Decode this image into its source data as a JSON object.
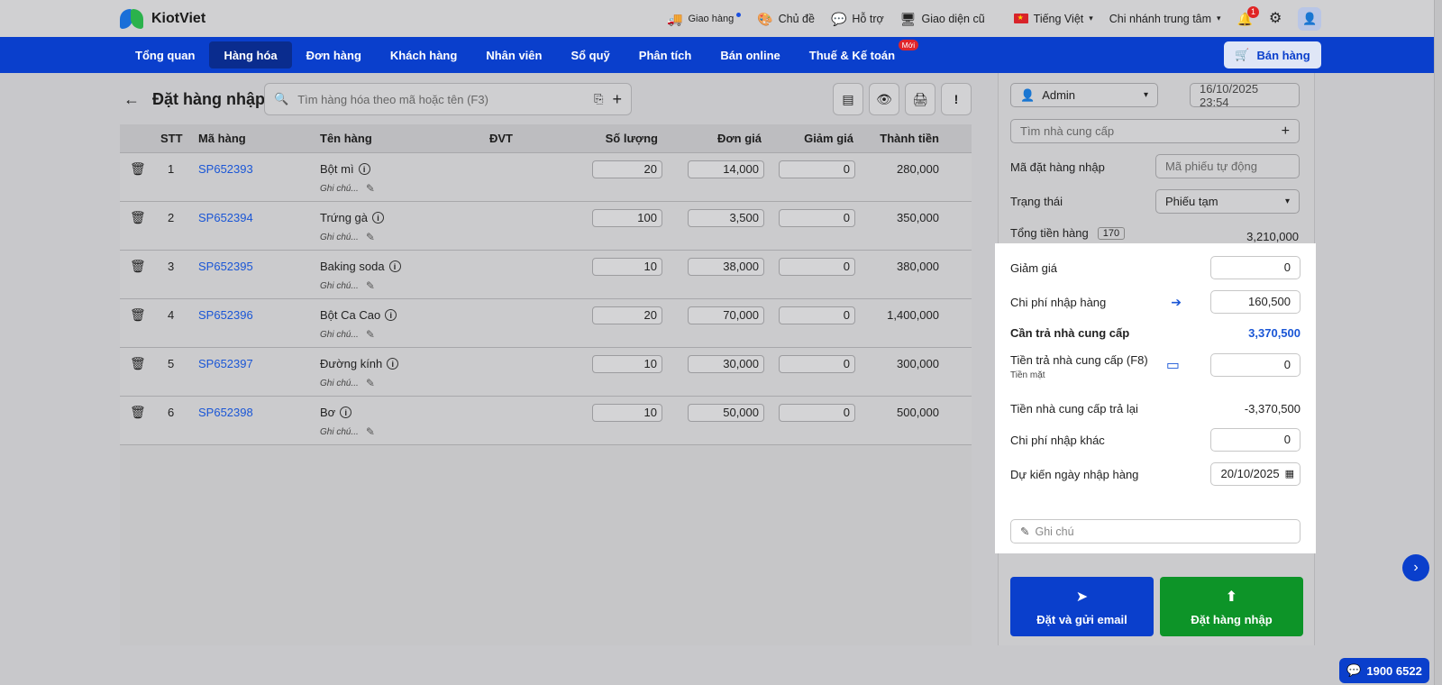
{
  "brand": {
    "name": "KiotViet"
  },
  "top_links": {
    "delivery": "Giao hàng",
    "theme": "Chủ đề",
    "support": "Hỗ trợ",
    "old_ui": "Giao diện cũ",
    "language": "Tiếng Việt",
    "branch": "Chi nhánh trung tâm",
    "notif_count": "1"
  },
  "nav": {
    "items": [
      "Tổng quan",
      "Hàng hóa",
      "Đơn hàng",
      "Khách hàng",
      "Nhân viên",
      "Sổ quỹ",
      "Phân tích",
      "Bán online",
      "Thuế & Kế toán"
    ],
    "new_badge": "Mới",
    "sell_button": "Bán hàng"
  },
  "page": {
    "title": "Đặt hàng nhập",
    "search_placeholder": "Tìm hàng hóa theo mã hoặc tên (F3)"
  },
  "table": {
    "headers": {
      "stt": "STT",
      "code": "Mã hàng",
      "name": "Tên hàng",
      "unit": "ĐVT",
      "qty": "Số lượng",
      "price": "Đơn giá",
      "discount": "Giảm giá",
      "total": "Thành tiền"
    },
    "note_label": "Ghi chú...",
    "rows": [
      {
        "stt": "1",
        "code": "SP652393",
        "name": "Bột mì",
        "qty": "20",
        "price": "14,000",
        "discount": "0",
        "total": "280,000"
      },
      {
        "stt": "2",
        "code": "SP652394",
        "name": "Trứng gà",
        "qty": "100",
        "price": "3,500",
        "discount": "0",
        "total": "350,000"
      },
      {
        "stt": "3",
        "code": "SP652395",
        "name": "Baking soda",
        "qty": "10",
        "price": "38,000",
        "discount": "0",
        "total": "380,000"
      },
      {
        "stt": "4",
        "code": "SP652396",
        "name": "Bột Ca Cao",
        "qty": "20",
        "price": "70,000",
        "discount": "0",
        "total": "1,400,000"
      },
      {
        "stt": "5",
        "code": "SP652397",
        "name": "Đường kính",
        "qty": "10",
        "price": "30,000",
        "discount": "0",
        "total": "300,000"
      },
      {
        "stt": "6",
        "code": "SP652398",
        "name": "Bơ",
        "qty": "10",
        "price": "50,000",
        "discount": "0",
        "total": "500,000"
      }
    ]
  },
  "panel": {
    "user": "Admin",
    "datetime": "16/10/2025 23:54",
    "supplier_placeholder": "Tìm nhà cung cấp",
    "order_code_label": "Mã đặt hàng nhập",
    "order_code_placeholder": "Mã phiếu tự động",
    "status_label": "Trạng thái",
    "status_value": "Phiếu tạm",
    "subtotal_label": "Tổng tiền hàng",
    "subtotal_count": "170",
    "subtotal_value": "3,210,000",
    "discount_label": "Giảm giá",
    "discount_value": "0",
    "import_cost_label": "Chi phí nhập hàng",
    "import_cost_value": "160,500",
    "payable_label": "Cần trả nhà cung cấp",
    "payable_value": "3,370,500",
    "paid_label": "Tiền trả nhà cung cấp (F8)",
    "paid_method": "Tiền mặt",
    "paid_value": "0",
    "refund_label": "Tiền nhà cung cấp trả lại",
    "refund_value": "-3,370,500",
    "other_cost_label": "Chi phí nhập khác",
    "other_cost_value": "0",
    "expected_date_label": "Dự kiến ngày nhập hàng",
    "expected_date_value": "20/10/2025",
    "note_placeholder": "Ghi chú",
    "btn_email": "Đặt và gửi email",
    "btn_order": "Đặt hàng nhập"
  },
  "hotline": "1900 6522"
}
